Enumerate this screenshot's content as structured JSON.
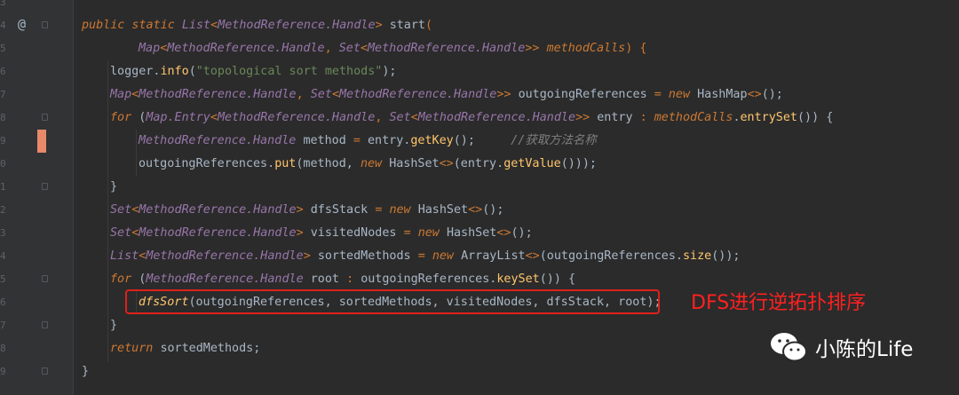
{
  "gutter": {
    "line_numbers": [
      "3",
      "4",
      "5",
      "6",
      "7",
      "8",
      "9",
      "0",
      "1",
      "2",
      "3",
      "4",
      "5",
      "6",
      "7",
      "8",
      "9"
    ],
    "annotation_symbol": "@"
  },
  "code": {
    "l1": {
      "a": "public static ",
      "b": "List",
      "c": "<",
      "d": "MethodReference.Handle",
      "e": "> ",
      "f": "start",
      "g": "("
    },
    "l2": {
      "a": "Map",
      "b": "<",
      "c": "MethodReference.Handle",
      ",": ", ",
      "d": "Set",
      "e": "<",
      "f": "MethodReference.Handle",
      "g": ">> ",
      "h": "methodCalls",
      "i": ") {"
    },
    "l3": {
      "a": "logger",
      "b": ".",
      "c": "info",
      "d": "(",
      "e": "\"topological sort methods\"",
      "f": ");"
    },
    "l4": {
      "a": "Map",
      "b": "<",
      "c": "MethodReference.Handle",
      "d": ", ",
      "e": "Set",
      "f": "<",
      "g": "MethodReference.Handle",
      "h": ">> ",
      "i": "outgoingReferences ",
      "j": "= ",
      "k": "new ",
      "l": "HashMap",
      "m": "<>",
      "n": "();"
    },
    "l5": {
      "a": "for ",
      "b": "(",
      "c": "Map.Entry",
      "d": "<",
      "e": "MethodReference.Handle",
      "f": ", ",
      "g": "Set",
      "h": "<",
      "i": "MethodReference.Handle",
      "j": ">> ",
      "k": "entry ",
      "l": ": ",
      "m": "methodCalls",
      "n": ".",
      "o": "entrySet",
      "p": "()) {"
    },
    "l6": {
      "a": "MethodReference.Handle ",
      "b": "method ",
      "c": "= ",
      "d": "entry.",
      "e": "getKey",
      "f": "();",
      "g": "     //获取方法名称"
    },
    "l7": {
      "a": "outgoingReferences.",
      "b": "put",
      "c": "(method, ",
      "d": "new ",
      "e": "HashSet",
      "f": "<>",
      "g": "(entry.",
      "h": "getValue",
      "i": "()));"
    },
    "l8": {
      "a": "}"
    },
    "l9": {
      "a": "Set",
      "b": "<",
      "c": "MethodReference.Handle",
      "d": "> ",
      "e": "dfsStack ",
      "f": "= ",
      "g": "new ",
      "h": "HashSet",
      "i": "<>",
      "j": "();"
    },
    "l10": {
      "a": "Set",
      "b": "<",
      "c": "MethodReference.Handle",
      "d": "> ",
      "e": "visitedNodes ",
      "f": "= ",
      "g": "new ",
      "h": "HashSet",
      "i": "<>",
      "j": "();"
    },
    "l11": {
      "a": "List",
      "b": "<",
      "c": "MethodReference.Handle",
      "d": "> ",
      "e": "sortedMethods ",
      "f": "= ",
      "g": "new ",
      "h": "ArrayList",
      "i": "<>",
      "j": "(outgoingReferences.",
      "k": "size",
      "l": "());"
    },
    "l12": {
      "a": "for ",
      "b": "(",
      "c": "MethodReference.Handle ",
      "d": "root ",
      "e": ": ",
      "f": "outgoingReferences.",
      "g": "keySet",
      "h": "()) {"
    },
    "l13": {
      "a": "dfsSort",
      "b": "(outgoingReferences, sortedMethods, visitedNodes, dfsStack, root);"
    },
    "l14": {
      "a": "}"
    },
    "l15": {
      "a": "return ",
      "b": "sortedMethods;"
    },
    "l16": {
      "a": "}"
    }
  },
  "annotation": "DFS进行逆拓扑排序",
  "watermark": "小陈的Life",
  "colors": {
    "highlight_box": "#e0201c",
    "annotation_text": "#ff2020",
    "keyword": "#cc7832",
    "type": "#9876aa",
    "method": "#ffc66d"
  }
}
